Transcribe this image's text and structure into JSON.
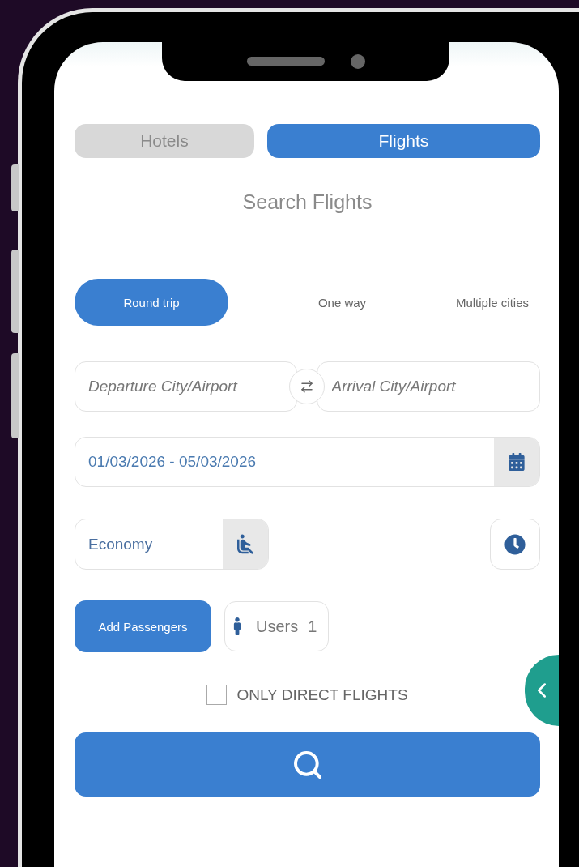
{
  "tabs": [
    {
      "label": "Hotels",
      "selected": false
    },
    {
      "label": "Flights",
      "selected": true
    }
  ],
  "title": "Search Flights",
  "trip_types": [
    {
      "label": "Round trip",
      "selected": true
    },
    {
      "label": "One way",
      "selected": false
    },
    {
      "label": "Multiple cities",
      "selected": false
    }
  ],
  "route": {
    "departure": {
      "placeholder": "Departure City/Airport"
    },
    "arrival": {
      "placeholder": "Arrival City/Airport"
    }
  },
  "dates": {
    "value": "01/03/2026 - 05/03/2026"
  },
  "cabin_class": {
    "value": "Economy"
  },
  "passengers": {
    "button": "Add Passengers",
    "label": "Users",
    "count": "1"
  },
  "direct_only": {
    "label": "ONLY DIRECT FLIGHTS",
    "checked": false
  }
}
